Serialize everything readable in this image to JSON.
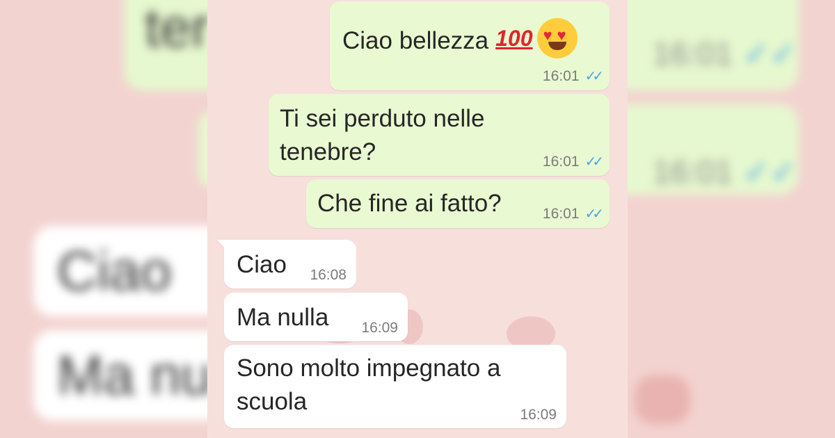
{
  "messages": [
    {
      "direction": "out",
      "text": "Ciao bellezza",
      "emojis": [
        "100-emoji",
        "heart-eyes-emoji"
      ],
      "emoji_100_text": "100",
      "time": "16:01",
      "status": "read"
    },
    {
      "direction": "out",
      "lines": [
        "Ti sei perduto nelle",
        "tenebre?"
      ],
      "time": "16:01",
      "status": "read"
    },
    {
      "direction": "out",
      "text": "Che fine ai fatto?",
      "time": "16:01",
      "status": "read"
    },
    {
      "direction": "in",
      "text": "Ciao",
      "time": "16:08"
    },
    {
      "direction": "in",
      "text": "Ma nulla",
      "time": "16:09"
    },
    {
      "direction": "in",
      "lines": [
        "Sono molto impegnato a",
        "scuola"
      ],
      "time": "16:09"
    }
  ],
  "background_blur": {
    "left": {
      "out_text": "ter",
      "in_texts": [
        "Ciao",
        "Ma nu"
      ]
    },
    "right": {
      "times": [
        "16:01",
        "16:01"
      ]
    }
  },
  "read_tick_glyph": "✓✓",
  "colors": {
    "background": "#efcfcd",
    "outgoing_bubble": "#e9f9d2",
    "incoming_bubble": "#ffffff",
    "read_ticks": "#4aa3e2",
    "timestamp": "#7b7b7b"
  }
}
